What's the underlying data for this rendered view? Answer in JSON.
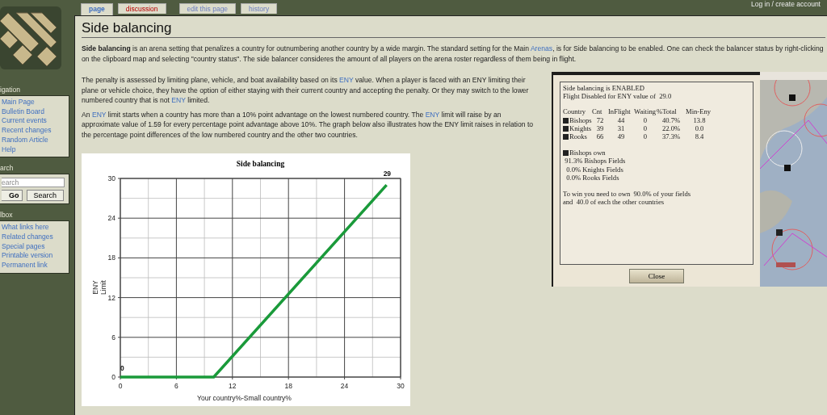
{
  "user_menu": {
    "label": "Log in / create account"
  },
  "sidebar": {
    "portlets": [
      {
        "heading": "igation",
        "links": [
          "Main Page",
          "Bulletin Board",
          "Current events",
          "Recent changes",
          "Random Article",
          "Help"
        ]
      },
      {
        "heading": "arch",
        "kind": "search",
        "placeholder": "earch",
        "buttons": [
          "Go",
          "Search"
        ]
      },
      {
        "heading": "lbox",
        "links": [
          "What links here",
          "Related changes",
          "Special pages",
          "Printable version",
          "Permanent link"
        ]
      }
    ]
  },
  "tabs": [
    {
      "label": "page",
      "selected": true,
      "missing": false
    },
    {
      "label": "discussion",
      "selected": false,
      "missing": true
    },
    {
      "label": "edit this page",
      "selected": false,
      "missing": false
    },
    {
      "label": "history",
      "selected": false,
      "missing": false
    }
  ],
  "title": "Side balancing",
  "intro": [
    {
      "kind": "bold",
      "text": "Side balancing"
    },
    {
      "kind": "text",
      "text": " is an arena setting that penalizes a country for outnumbering another country by a wide margin. The standard setting for the Main "
    },
    {
      "kind": "link",
      "text": "Arenas"
    },
    {
      "kind": "text",
      "text": ", is for Side balancing to be enabled. One can check the balancer status by right-clicking on the clipboard map and selecting \"country status\". The side balancer consideres the amount of all players on the arena roster regardless of them being in flight."
    }
  ],
  "paragraphs": [
    [
      {
        "kind": "text",
        "text": "The penalty is assessed by limiting plane, vehicle, and boat availability based on its "
      },
      {
        "kind": "link",
        "text": "ENY"
      },
      {
        "kind": "text",
        "text": " value. When a player is faced with an ENY limiting their plane or vehicle choice, they have the option of either staying with their current country and accepting the penalty. Or they may switch to the lower numbered country that is not "
      },
      {
        "kind": "link",
        "text": "ENY"
      },
      {
        "kind": "text",
        "text": " limited."
      }
    ],
    [
      {
        "kind": "text",
        "text": "An "
      },
      {
        "kind": "link",
        "text": "ENY"
      },
      {
        "kind": "text",
        "text": " limit starts when a country has more than a 10% point advantage on the lowest numbered country. The "
      },
      {
        "kind": "link",
        "text": "ENY"
      },
      {
        "kind": "text",
        "text": " limit will raise by an approximate value of 1.59 for every percentage point advantage above 10%. The graph below also illustrates how the ENY limit raises in relation to the percentage point differences of the low numbered country and the other two countries."
      }
    ]
  ],
  "chart": {
    "chart_data": {
      "type": "line",
      "title": "Side balancing",
      "xlabel": "Your country%-Small country%",
      "ylabel": "ENY Limit",
      "x": [
        0,
        10,
        28.5
      ],
      "series": [
        {
          "color": "#1a9a3a",
          "values": [
            0,
            0,
            29
          ]
        }
      ],
      "grid": true,
      "value_labels": [
        "0",
        null,
        "29"
      ],
      "xlim": [
        0,
        30
      ],
      "ylim": [
        0,
        30
      ],
      "xticks": [
        0,
        6,
        12,
        18,
        24,
        30
      ],
      "yticks": [
        0,
        6,
        12,
        18,
        24,
        30
      ]
    }
  },
  "game_dialog": {
    "status": "Side balancing is ENABLED",
    "flight_disabled": "Flight Disabled for ENY value of  29.0",
    "columns": [
      "Country",
      "Cnt",
      "InFlight",
      "Waiting",
      "%Total",
      "Min-Eny"
    ],
    "rows": [
      [
        "Bishops",
        "72",
        "44",
        "0",
        "40.7%",
        "13.8"
      ],
      [
        "Knights",
        "39",
        "31",
        "0",
        "22.0%",
        "0.0"
      ],
      [
        "Rooks",
        "66",
        "49",
        "0",
        "37.3%",
        "8.4"
      ]
    ],
    "ownership_heading": "Bishops own",
    "ownership": [
      "91.3% Bishops Fields",
      " 0.0% Knights Fields",
      " 0.0% Rooks Fields"
    ],
    "win_text": [
      "To win you need to own  90.0% of your fields",
      "and  40.0 of each the other countries"
    ],
    "close_button": "Close"
  },
  "map": {
    "kind": "picture"
  }
}
